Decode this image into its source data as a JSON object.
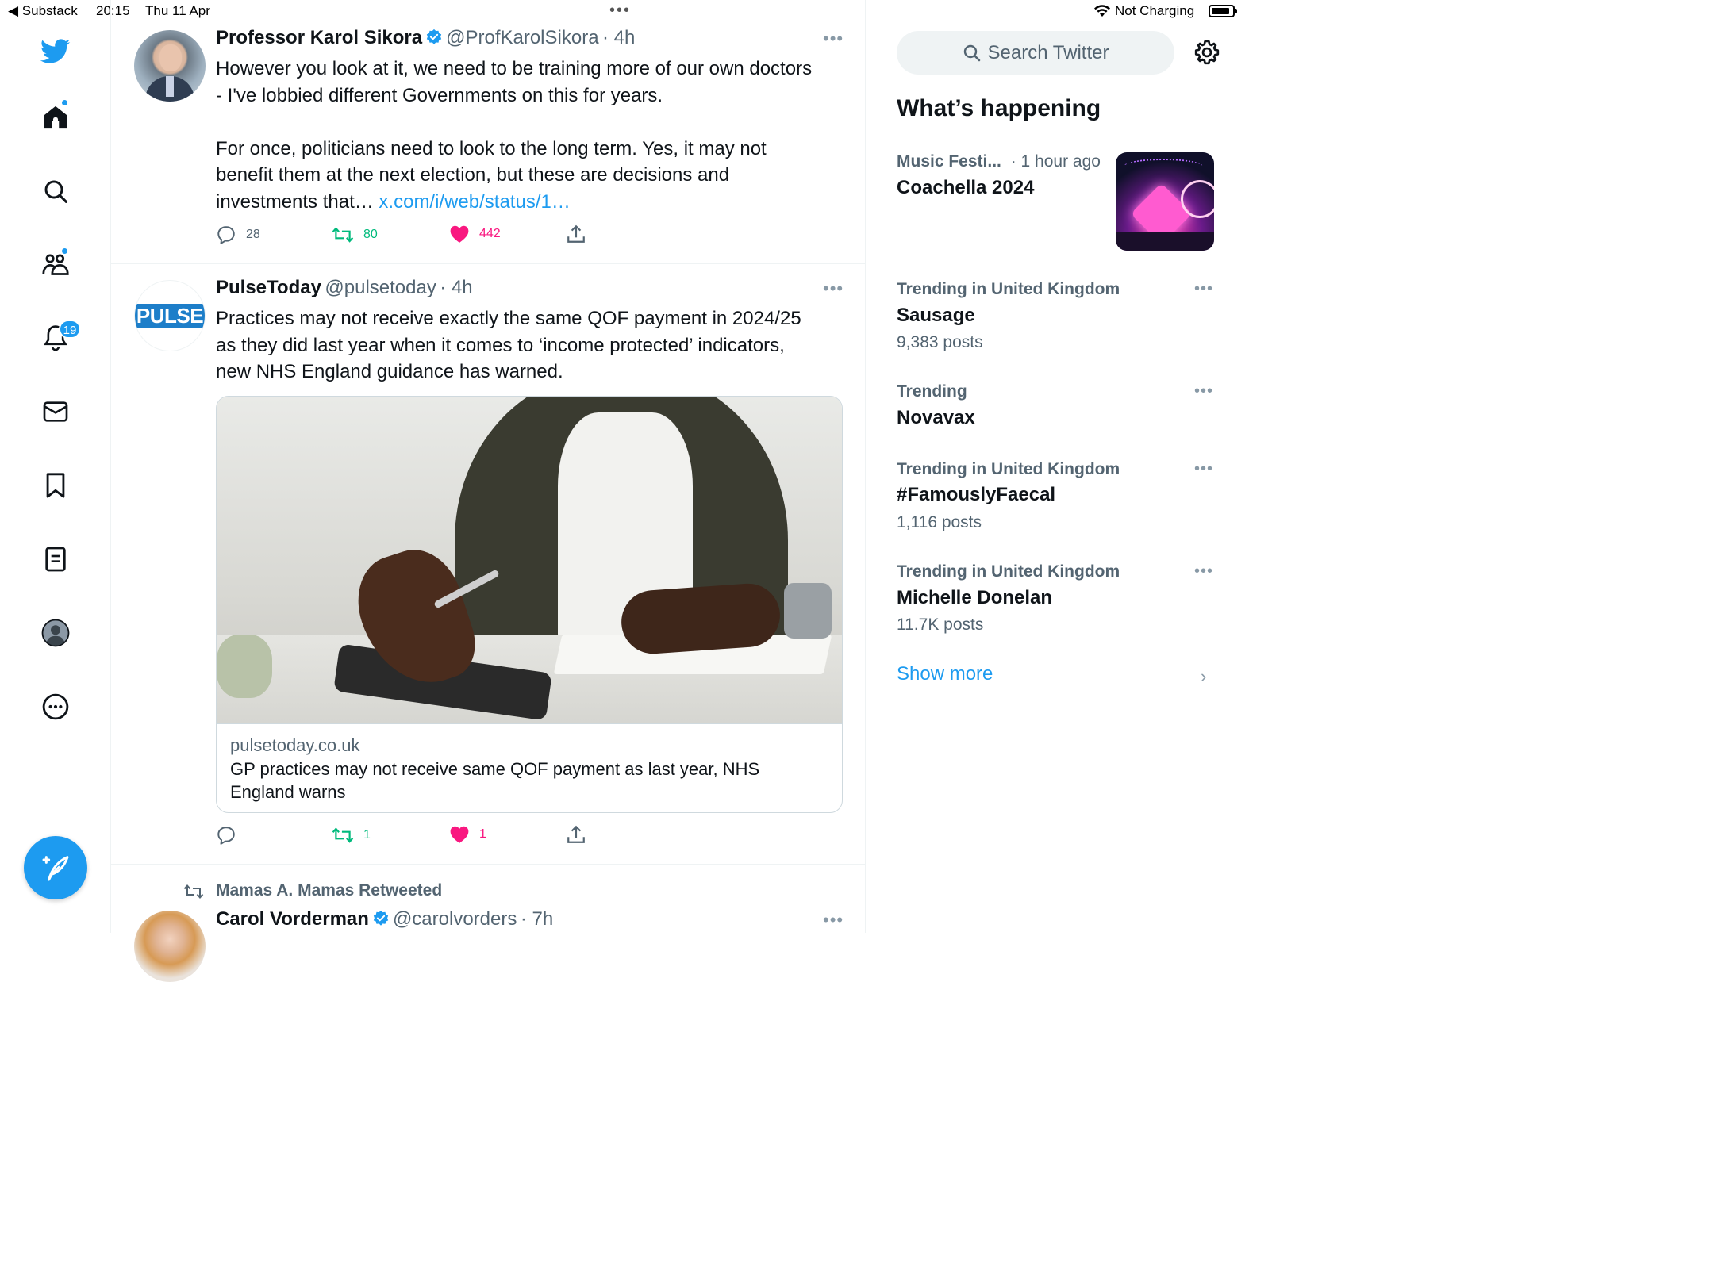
{
  "status_bar": {
    "back_app": "◀ Substack",
    "time": "20:15",
    "date": "Thu 11 Apr",
    "charging": "Not Charging"
  },
  "nav": {
    "notifications_count": "19",
    "icons": [
      "twitter-logo-icon",
      "home-icon",
      "search-icon",
      "communities-icon",
      "notifications-icon",
      "messages-icon",
      "bookmarks-icon",
      "lists-icon",
      "profile-icon",
      "more-icon",
      "compose-icon"
    ],
    "accent": "#1d9bf0"
  },
  "tweets": [
    {
      "name": "Professor Karol Sikora",
      "handle": "@ProfKarolSikora",
      "time": "· 4h",
      "text_line1": "However you look at it, we need to be training more of our own doctors",
      "text_line2": "- I've lobbied different Governments on this for years.",
      "text_line3": "For once, politicians need to look to the long term. Yes, it may not",
      "text_line4": "benefit them at the next election, but these are decisions and",
      "text_line5": "investments that…",
      "link": "x.com/i/web/status/1…",
      "replies": "28",
      "retweets": "80",
      "likes": "442"
    },
    {
      "name": "PulseToday",
      "handle": "@pulsetoday",
      "time": "· 4h",
      "avatar_text": "PULSE",
      "text_line1": "Practices may not receive exactly the same QOF payment in 2024/25",
      "text_line2": "as they did last year when it comes to ‘income protected’ indicators,",
      "text_line3": "new NHS England guidance has warned.",
      "card_domain": "pulsetoday.co.uk",
      "card_title_line1": "GP practices may not receive same QOF payment as last year, NHS",
      "card_title_line2": "England warns",
      "retweets": "1",
      "likes": "1"
    },
    {
      "retweeted_by": "Mamas A. Mamas Retweeted",
      "name": "Carol Vorderman",
      "handle": "@carolvorders",
      "time": "· 7h"
    }
  ],
  "sidebar": {
    "search_placeholder": "Search Twitter",
    "title": "What’s happening",
    "featured": {
      "context": "Music Festi...",
      "age": "· 1 hour ago",
      "name": "Coachella 2024"
    },
    "trends": [
      {
        "context": "Trending in United Kingdom",
        "name": "Sausage",
        "count": "9,383 posts"
      },
      {
        "context": "Trending",
        "name": "Novavax",
        "count": ""
      },
      {
        "context": "Trending in United Kingdom",
        "name": "#FamouslyFaecal",
        "count": "1,116 posts"
      },
      {
        "context": "Trending in United Kingdom",
        "name": "Michelle Donelan",
        "count": "11.7K posts"
      }
    ],
    "show_more": "Show more"
  },
  "colors": {
    "retweet": "#00ba7c",
    "like": "#f91880",
    "link": "#1d9bf0",
    "secondary": "#536471"
  }
}
